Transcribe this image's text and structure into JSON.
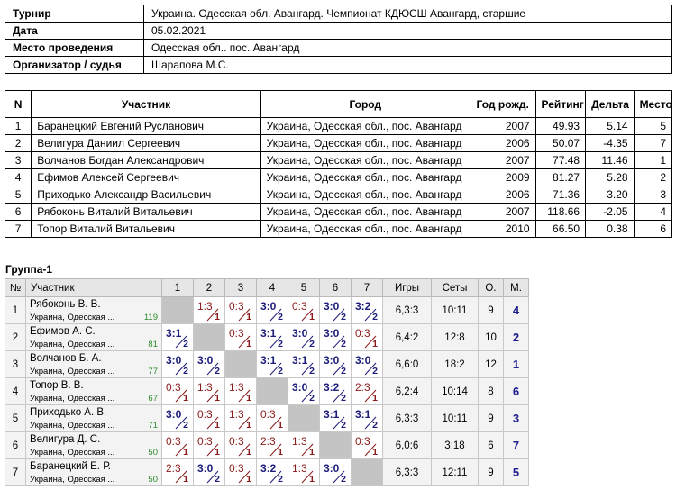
{
  "info": {
    "rows": [
      {
        "key": "Турнир",
        "value": "Украина. Одесская обл. Авангард. Чемпионат КДЮСШ Авангард, старшие"
      },
      {
        "key": "Дата",
        "value": "05.02.2021"
      },
      {
        "key": "Место проведения",
        "value": "Одесская обл.. пос. Авангард"
      },
      {
        "key": "Организатор / судья",
        "value": "Шарапова М.С."
      }
    ]
  },
  "participants": {
    "headers": {
      "n": "N",
      "name": "Участник",
      "city": "Город",
      "year": "Год рожд.",
      "rating": "Рейтинг",
      "delta": "Дельта",
      "place": "Место"
    },
    "rows": [
      {
        "n": "1",
        "name": "Баранецкий Евгений Русланович",
        "city": "Украина, Одесская обл., пос. Авангард",
        "year": "2007",
        "rating": "49.93",
        "delta": "5.14",
        "place": "5"
      },
      {
        "n": "2",
        "name": "Велигура Даниил Сергеевич",
        "city": "Украина, Одесская обл., пос. Авангард",
        "year": "2006",
        "rating": "50.07",
        "delta": "-4.35",
        "place": "7"
      },
      {
        "n": "3",
        "name": "Волчанов Богдан Александрович",
        "city": "Украина, Одесская обл., пос. Авангард",
        "year": "2007",
        "rating": "77.48",
        "delta": "11.46",
        "place": "1"
      },
      {
        "n": "4",
        "name": "Ефимов Алексей Сергеевич",
        "city": "Украина, Одесская обл., пос. Авангард",
        "year": "2009",
        "rating": "81.27",
        "delta": "5.28",
        "place": "2"
      },
      {
        "n": "5",
        "name": "Приходько Александр Васильевич",
        "city": "Украина, Одесская обл., пос. Авангард",
        "year": "2006",
        "rating": "71.36",
        "delta": "3.20",
        "place": "3"
      },
      {
        "n": "6",
        "name": "Рябоконь Виталий Витальевич",
        "city": "Украина, Одесская обл., пос. Авангард",
        "year": "2007",
        "rating": "118.66",
        "delta": "-2.05",
        "place": "4"
      },
      {
        "n": "7",
        "name": "Топор Виталий Витальевич",
        "city": "Украина, Одесская обл., пос. Авангард",
        "year": "2010",
        "rating": "66.50",
        "delta": "0.38",
        "place": "6"
      }
    ]
  },
  "group": {
    "title": "Группа-1",
    "headers": {
      "n": "№",
      "player": "Участник",
      "cols": [
        "1",
        "2",
        "3",
        "4",
        "5",
        "6",
        "7"
      ],
      "games": "Игры",
      "sets": "Сеты",
      "points": "О.",
      "place": "М."
    },
    "colors": {
      "win": "#1c1c7a",
      "loss": "#8b1a1a",
      "rating": "#2b8a2b",
      "self": "#c4c4c4"
    },
    "rows": [
      {
        "n": "1",
        "name": "Рябоконь В. В.",
        "city": "Украина, Одесская ...",
        "rating": "119",
        "results": [
          null,
          {
            "score": "1:3",
            "pts": "1"
          },
          {
            "score": "0:3",
            "pts": "1"
          },
          {
            "score": "3:0",
            "pts": "2"
          },
          {
            "score": "0:3",
            "pts": "1"
          },
          {
            "score": "3:0",
            "pts": "2"
          },
          {
            "score": "3:2",
            "pts": "2"
          }
        ],
        "games": "6,3:3",
        "sets": "10:11",
        "points": "9",
        "place": "4"
      },
      {
        "n": "2",
        "name": "Ефимов А. С.",
        "city": "Украина, Одесская ...",
        "rating": "81",
        "results": [
          {
            "score": "3:1",
            "pts": "2"
          },
          null,
          {
            "score": "0:3",
            "pts": "1"
          },
          {
            "score": "3:1",
            "pts": "2"
          },
          {
            "score": "3:0",
            "pts": "2"
          },
          {
            "score": "3:0",
            "pts": "2"
          },
          {
            "score": "0:3",
            "pts": "1"
          }
        ],
        "games": "6,4:2",
        "sets": "12:8",
        "points": "10",
        "place": "2"
      },
      {
        "n": "3",
        "name": "Волчанов Б. А.",
        "city": "Украина, Одесская ...",
        "rating": "77",
        "results": [
          {
            "score": "3:0",
            "pts": "2"
          },
          {
            "score": "3:0",
            "pts": "2"
          },
          null,
          {
            "score": "3:1",
            "pts": "2"
          },
          {
            "score": "3:1",
            "pts": "2"
          },
          {
            "score": "3:0",
            "pts": "2"
          },
          {
            "score": "3:0",
            "pts": "2"
          }
        ],
        "games": "6,6:0",
        "sets": "18:2",
        "points": "12",
        "place": "1"
      },
      {
        "n": "4",
        "name": "Топор В. В.",
        "city": "Украина, Одесская ...",
        "rating": "67",
        "results": [
          {
            "score": "0:3",
            "pts": "1"
          },
          {
            "score": "1:3",
            "pts": "1"
          },
          {
            "score": "1:3",
            "pts": "1"
          },
          null,
          {
            "score": "3:0",
            "pts": "2"
          },
          {
            "score": "3:2",
            "pts": "2"
          },
          {
            "score": "2:3",
            "pts": "1"
          }
        ],
        "games": "6,2:4",
        "sets": "10:14",
        "points": "8",
        "place": "6"
      },
      {
        "n": "5",
        "name": "Приходько А. В.",
        "city": "Украина, Одесская ...",
        "rating": "71",
        "results": [
          {
            "score": "3:0",
            "pts": "2"
          },
          {
            "score": "0:3",
            "pts": "1"
          },
          {
            "score": "1:3",
            "pts": "1"
          },
          {
            "score": "0:3",
            "pts": "1"
          },
          null,
          {
            "score": "3:1",
            "pts": "2"
          },
          {
            "score": "3:1",
            "pts": "2"
          }
        ],
        "games": "6,3:3",
        "sets": "10:11",
        "points": "9",
        "place": "3"
      },
      {
        "n": "6",
        "name": "Велигура Д. С.",
        "city": "Украина, Одесская ...",
        "rating": "50",
        "results": [
          {
            "score": "0:3",
            "pts": "1"
          },
          {
            "score": "0:3",
            "pts": "1"
          },
          {
            "score": "0:3",
            "pts": "1"
          },
          {
            "score": "2:3",
            "pts": "1"
          },
          {
            "score": "1:3",
            "pts": "1"
          },
          null,
          {
            "score": "0:3",
            "pts": "1"
          }
        ],
        "games": "6,0:6",
        "sets": "3:18",
        "points": "6",
        "place": "7"
      },
      {
        "n": "7",
        "name": "Баранецкий Е. Р.",
        "city": "Украина, Одесская ...",
        "rating": "50",
        "results": [
          {
            "score": "2:3",
            "pts": "1"
          },
          {
            "score": "3:0",
            "pts": "2"
          },
          {
            "score": "0:3",
            "pts": "1"
          },
          {
            "score": "3:2",
            "pts": "2"
          },
          {
            "score": "1:3",
            "pts": "1"
          },
          {
            "score": "3:0",
            "pts": "2"
          },
          null
        ],
        "games": "6,3:3",
        "sets": "12:11",
        "points": "9",
        "place": "5"
      }
    ]
  }
}
